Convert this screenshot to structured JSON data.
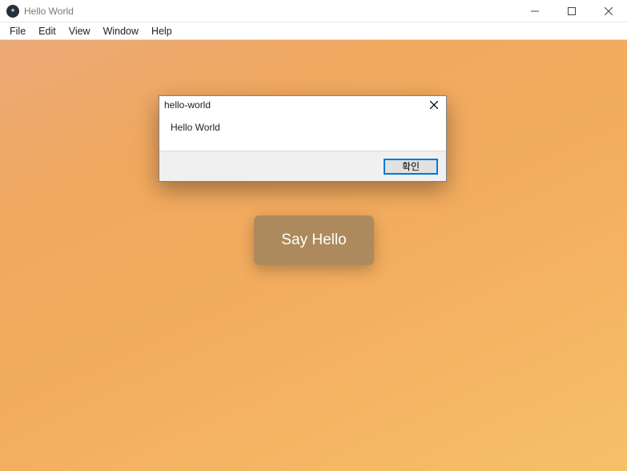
{
  "window": {
    "title": "Hello World"
  },
  "menu": {
    "file": "File",
    "edit": "Edit",
    "view": "View",
    "window": "Window",
    "help": "Help"
  },
  "main": {
    "say_hello_label": "Say Hello"
  },
  "dialog": {
    "title": "hello-world",
    "message": "Hello World",
    "ok_label": "확인"
  }
}
